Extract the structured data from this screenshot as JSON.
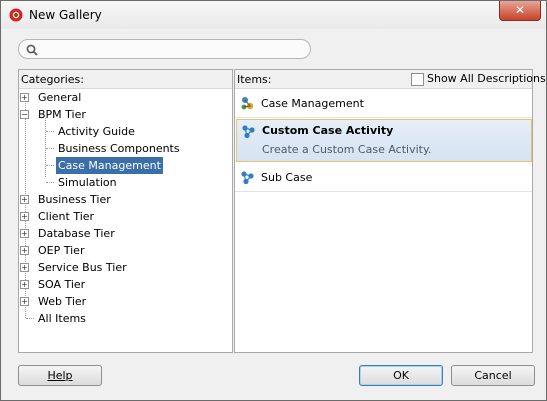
{
  "window": {
    "title": "New Gallery",
    "close_glyph": "✕"
  },
  "search": {
    "value": "",
    "placeholder": ""
  },
  "categories": {
    "header": "Categories:",
    "tree": [
      {
        "label": "General",
        "toggle": "+",
        "level": 0
      },
      {
        "label": "BPM Tier",
        "toggle": "−",
        "level": 0
      },
      {
        "label": "Activity Guide",
        "level": 1
      },
      {
        "label": "Business Components",
        "level": 1
      },
      {
        "label": "Case Management",
        "level": 1,
        "selected": true
      },
      {
        "label": "Simulation",
        "level": 1
      },
      {
        "label": "Business Tier",
        "toggle": "+",
        "level": 0
      },
      {
        "label": "Client Tier",
        "toggle": "+",
        "level": 0
      },
      {
        "label": "Database Tier",
        "toggle": "+",
        "level": 0
      },
      {
        "label": "OEP Tier",
        "toggle": "+",
        "level": 0
      },
      {
        "label": "Service Bus Tier",
        "toggle": "+",
        "level": 0
      },
      {
        "label": "SOA Tier",
        "toggle": "+",
        "level": 0
      },
      {
        "label": "Web Tier",
        "toggle": "+",
        "level": 0
      },
      {
        "label": "All Items",
        "level": 0
      }
    ]
  },
  "items": {
    "header": "Items:",
    "show_all_label": "Show All Descriptions",
    "show_all_checked": false,
    "list": [
      {
        "label": "Case Management",
        "icon": "case-management-icon"
      },
      {
        "label": "Custom Case Activity",
        "description": "Create a Custom Case Activity.",
        "icon": "custom-case-activity-icon",
        "selected": true
      },
      {
        "label": "Sub Case",
        "icon": "sub-case-icon"
      }
    ]
  },
  "buttons": {
    "help": "Help",
    "ok": "OK",
    "cancel": "Cancel"
  },
  "colors": {
    "selection": "#3b6fa8",
    "item_selection_border": "#e6c46a",
    "close_button": "#c7432b"
  }
}
